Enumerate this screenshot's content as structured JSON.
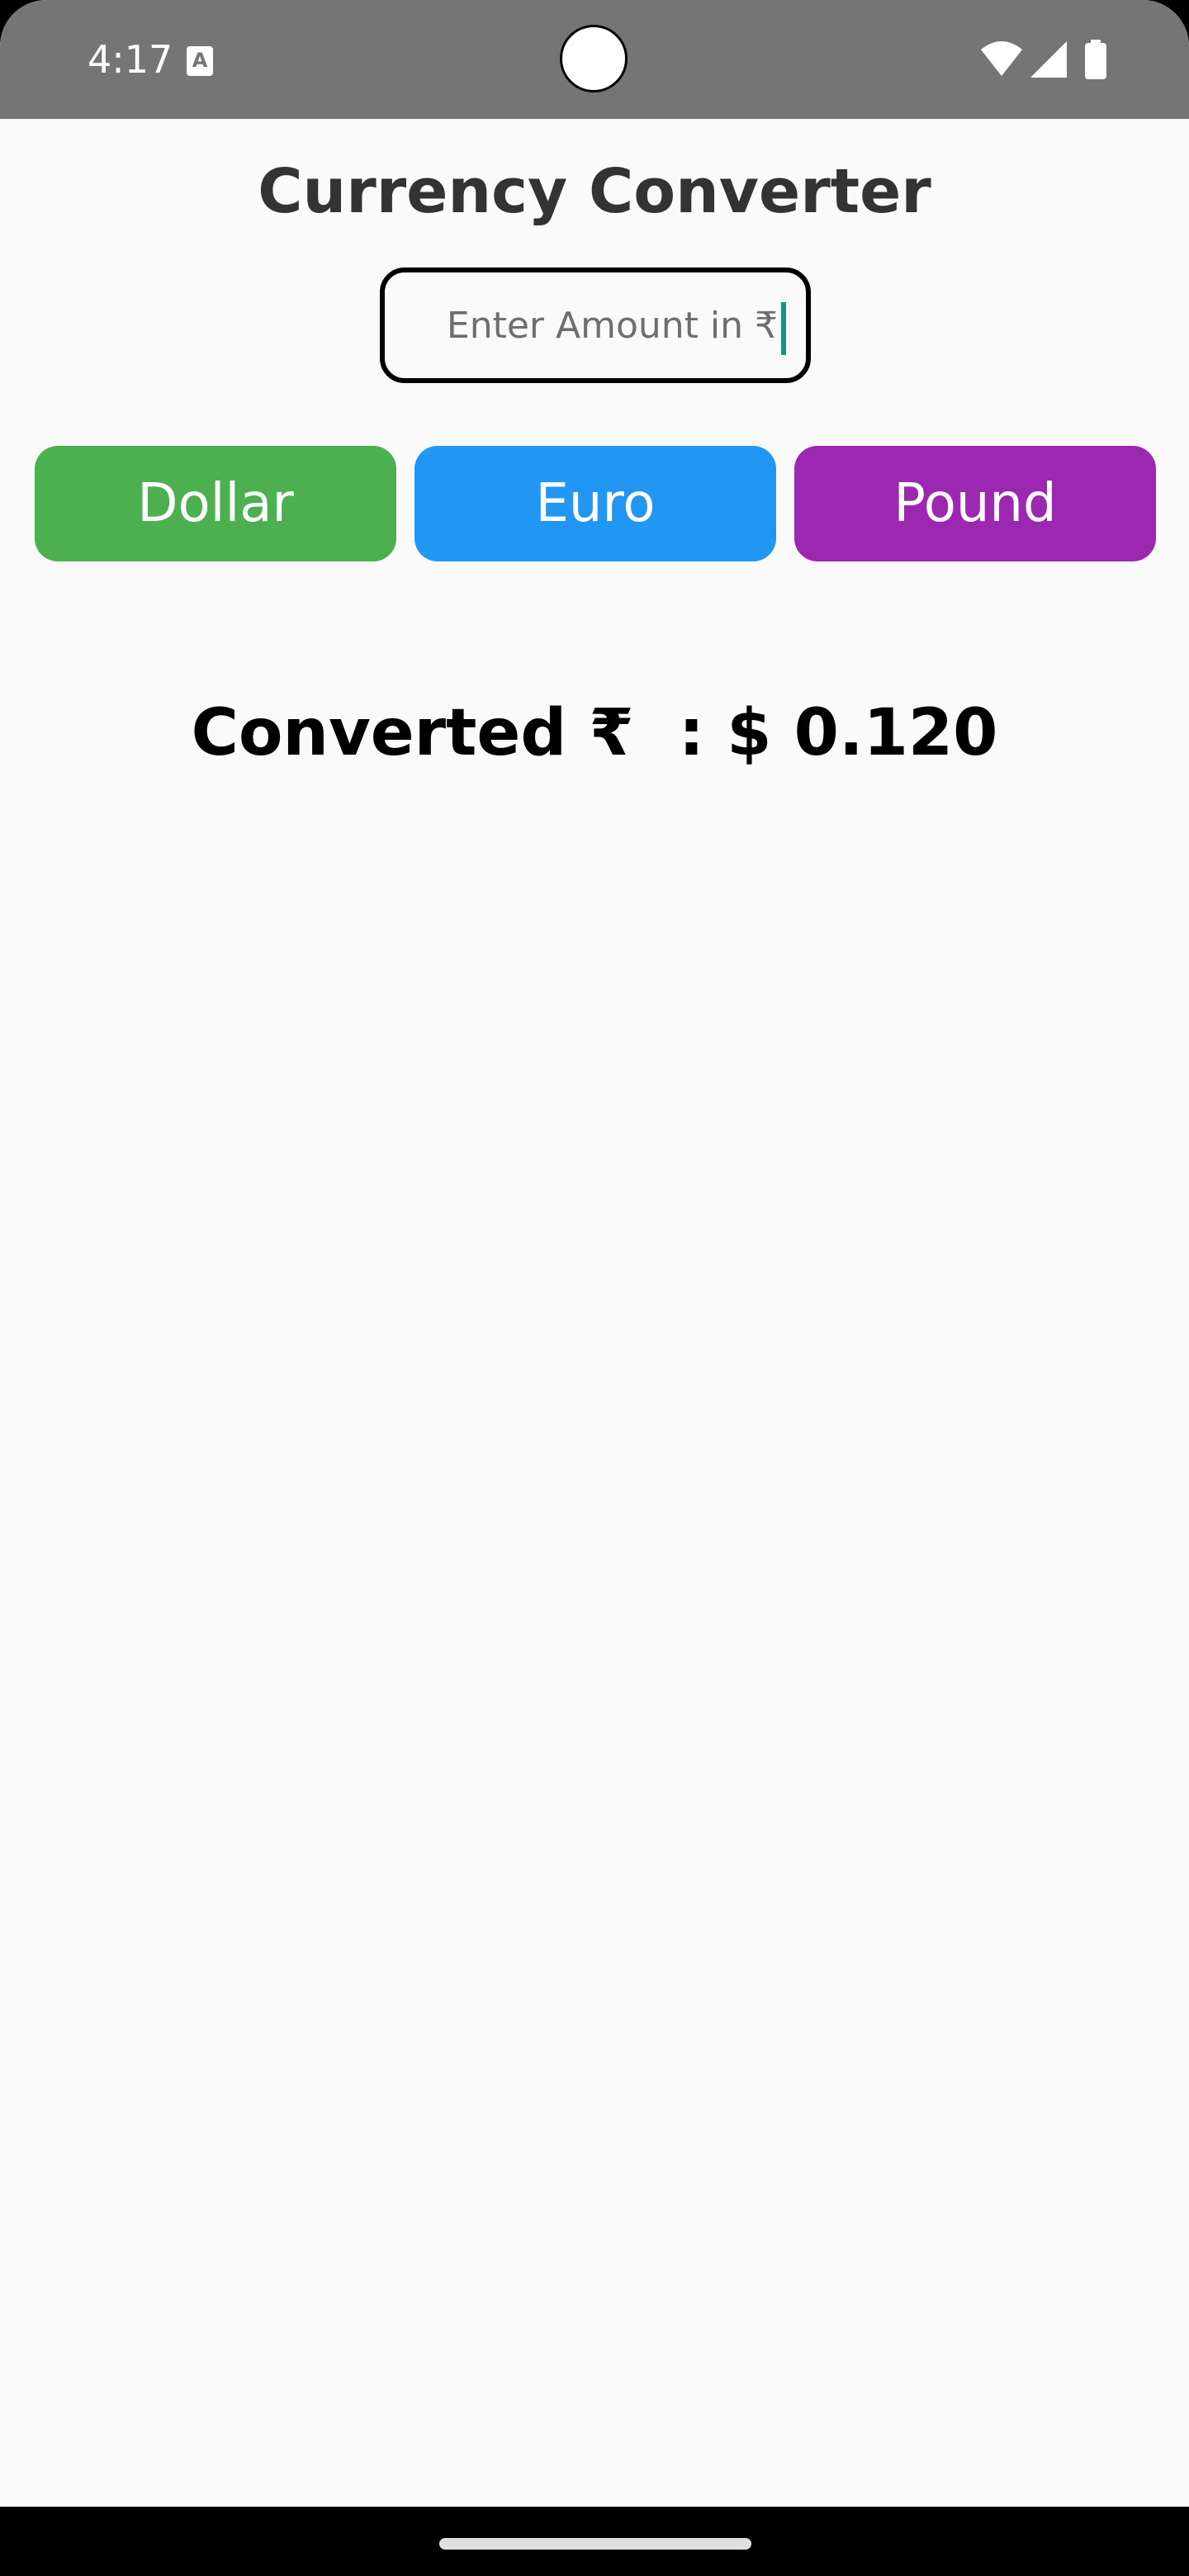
{
  "status_bar": {
    "time": "4:17",
    "notification_icon": "text-a-icon",
    "notification_letter": "A",
    "icons": [
      "wifi-icon",
      "cell-signal-icon",
      "battery-icon"
    ]
  },
  "app": {
    "title": "Currency Converter",
    "amount_input": {
      "placeholder": "Enter Amount in ₹",
      "value": ""
    },
    "buttons": [
      {
        "label": "Dollar",
        "color": "#4caf50"
      },
      {
        "label": "Euro",
        "color": "#2196f3"
      },
      {
        "label": "Pound",
        "color": "#9c27b0"
      }
    ],
    "result_text": "Converted ₹  : $ 0.120"
  },
  "colors": {
    "status_bar": "#757575",
    "background": "#fafafa",
    "cursor": "#1f8f86"
  }
}
